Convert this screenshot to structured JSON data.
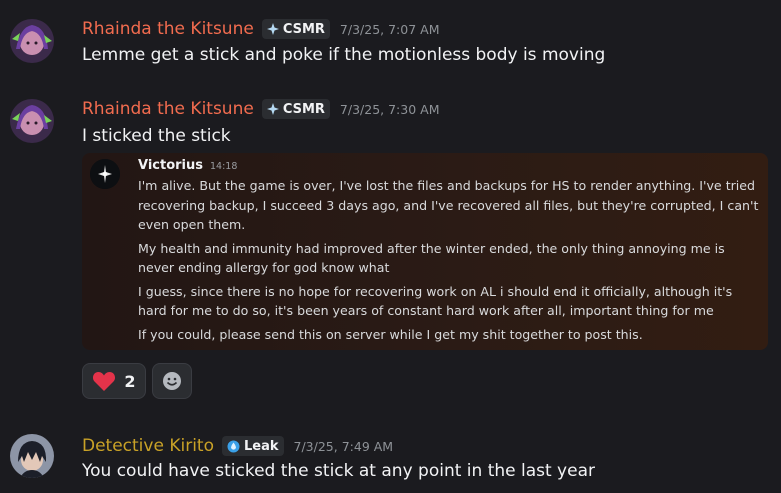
{
  "messages": [
    {
      "author": "Rhainda the Kitsune",
      "author_color": "#f26c4f",
      "tag": "CSMR",
      "timestamp": "7/3/25, 7:07 AM",
      "text": "Lemme get a stick and poke if the motionless body is moving"
    },
    {
      "author": "Rhainda the Kitsune",
      "author_color": "#f26c4f",
      "tag": "CSMR",
      "timestamp": "7/3/25, 7:30 AM",
      "text": "I sticked the stick",
      "embed": {
        "author": "Victorius",
        "time": "14:18",
        "paragraphs": [
          "I'm alive. But the game is over, I've lost the files and backups for HS to render anything. I've tried recovering backup, I succeed 3 days ago, and I've recovered all files, but they're corrupted, I can't even open them.",
          "My health and immunity had improved after the winter ended, the only thing annoying me is never ending allergy for god know what",
          "I guess, since there is no hope for recovering work on AL i should end it officially, although it's hard for me to do so, it's been years of constant hard work after all, important thing for me",
          "If you could, please send this on server while I get my shit together to post this."
        ]
      },
      "reactions": {
        "heart_icon": "heart-icon",
        "heart_count": "2",
        "add_icon": "add-reaction-icon"
      }
    },
    {
      "author": "Detective Kirito",
      "author_color": "#c9a227",
      "tag": "Leak",
      "timestamp": "7/3/25, 7:49 AM",
      "text": "You could have sticked the stick at any point in the last year"
    }
  ]
}
